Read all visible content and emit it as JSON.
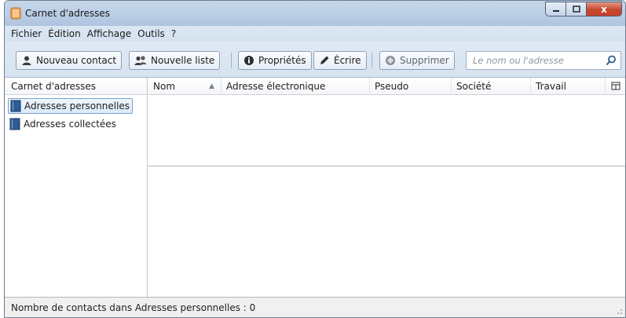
{
  "window": {
    "title": "Carnet d'adresses",
    "close_glyph": "x",
    "accent_color": "#c5472c"
  },
  "menu": [
    {
      "label": "Fichier"
    },
    {
      "label": "Édition"
    },
    {
      "label": "Affichage"
    },
    {
      "label": "Outils"
    },
    {
      "label": "?"
    }
  ],
  "toolbar": {
    "new_contact": {
      "label": "Nouveau contact",
      "icon": "contact-icon"
    },
    "new_list": {
      "label": "Nouvelle liste",
      "icon": "list-icon"
    },
    "properties": {
      "label": "Propriétés",
      "icon": "info-icon"
    },
    "write": {
      "label": "Écrire",
      "icon": "pencil-icon"
    },
    "delete": {
      "label": "Supprimer",
      "icon": "delete-icon",
      "enabled": false
    },
    "search": {
      "placeholder": "Le nom ou l'adresse",
      "icon": "search-icon"
    }
  },
  "books_pane": {
    "header": "Carnet d'adresses",
    "items": [
      {
        "label": "Adresses personnelles",
        "selected": true
      },
      {
        "label": "Adresses collectées",
        "selected": false
      }
    ]
  },
  "columns": [
    {
      "label": "Nom",
      "sorted": "ascending"
    },
    {
      "label": "Adresse électronique"
    },
    {
      "label": "Pseudo"
    },
    {
      "label": "Société"
    },
    {
      "label": "Travail"
    }
  ],
  "column_picker_icon": "column-picker-icon",
  "status": {
    "text": "Nombre de contacts dans Adresses personnelles : 0"
  }
}
